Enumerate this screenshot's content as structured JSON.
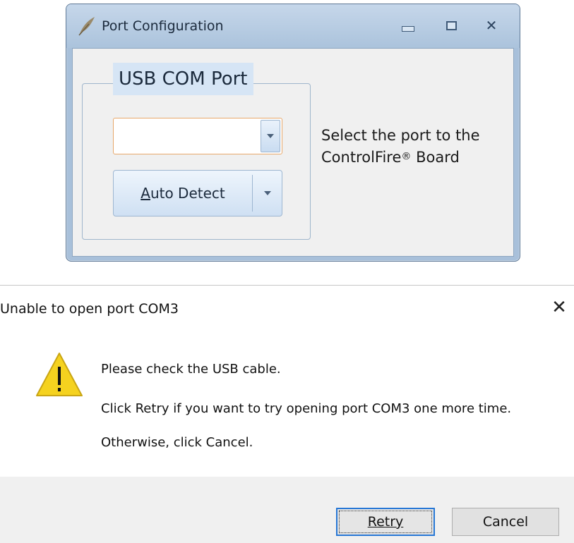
{
  "port_config": {
    "title": "Port Configuration",
    "app_icon": "feather-icon",
    "group_title": "USB COM Port",
    "port_value": "",
    "auto_detect_label_first": "A",
    "auto_detect_label_rest": "uto Detect",
    "instruction_line1": "Select the port to the",
    "instruction_line2": "ControlFire",
    "registered_mark": "®",
    "instruction_line2_end": " Board"
  },
  "error_dialog": {
    "title": "Unable to open port COM3",
    "close_glyph": "✕",
    "icon": "warning-icon",
    "message_line1": "Please check the USB cable.",
    "message_line2": "Click Retry if you want to try opening port COM3 one more time.",
    "message_line3": "Otherwise, click Cancel.",
    "retry_label": "Retry",
    "cancel_label": "Cancel"
  },
  "colors": {
    "window_frame": "#a8c0da",
    "button_blue": "#2777d5",
    "warning_yellow": "#f5d21f"
  }
}
